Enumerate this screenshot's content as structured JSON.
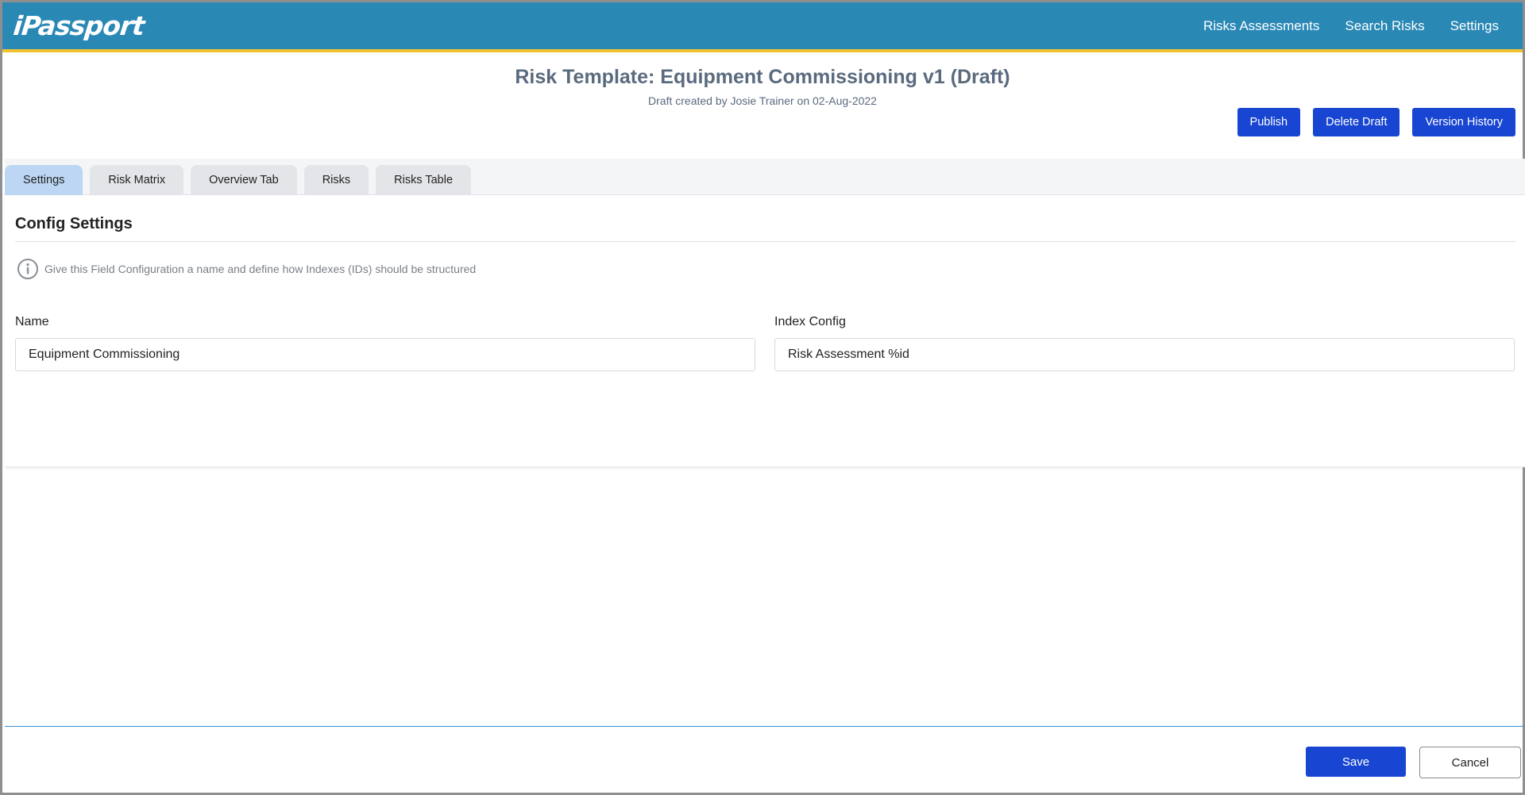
{
  "app": {
    "logo": "iPassport"
  },
  "nav": {
    "items": [
      {
        "label": "Risks Assessments"
      },
      {
        "label": "Search Risks"
      },
      {
        "label": "Settings"
      }
    ]
  },
  "header": {
    "title_prefix": "Risk Template: Equipment Commissioning",
    "title_version": "v1 (Draft)",
    "subtitle": "Draft created by Josie Trainer on 02-Aug-2022",
    "actions": {
      "publish": "Publish",
      "delete_draft": "Delete Draft",
      "version_history": "Version History"
    }
  },
  "tabs": [
    {
      "label": "Settings",
      "active": true
    },
    {
      "label": "Risk Matrix",
      "active": false
    },
    {
      "label": "Overview Tab",
      "active": false
    },
    {
      "label": "Risks",
      "active": false
    },
    {
      "label": "Risks Table",
      "active": false
    }
  ],
  "config": {
    "section_title": "Config Settings",
    "info_icon": "info-circle-icon",
    "info_text": "Give this Field Configuration a name and define how Indexes (IDs) should be structured",
    "name_label": "Name",
    "name_value": "Equipment Commissioning",
    "index_label": "Index Config",
    "index_value": "Risk Assessment %id"
  },
  "footer": {
    "save": "Save",
    "cancel": "Cancel"
  },
  "colors": {
    "topbar": "#2a88b5",
    "topbar_accent": "#f2c230",
    "primary_button": "#1845d1",
    "active_tab": "#bcd6f3",
    "title_text": "#5a6a7e"
  }
}
